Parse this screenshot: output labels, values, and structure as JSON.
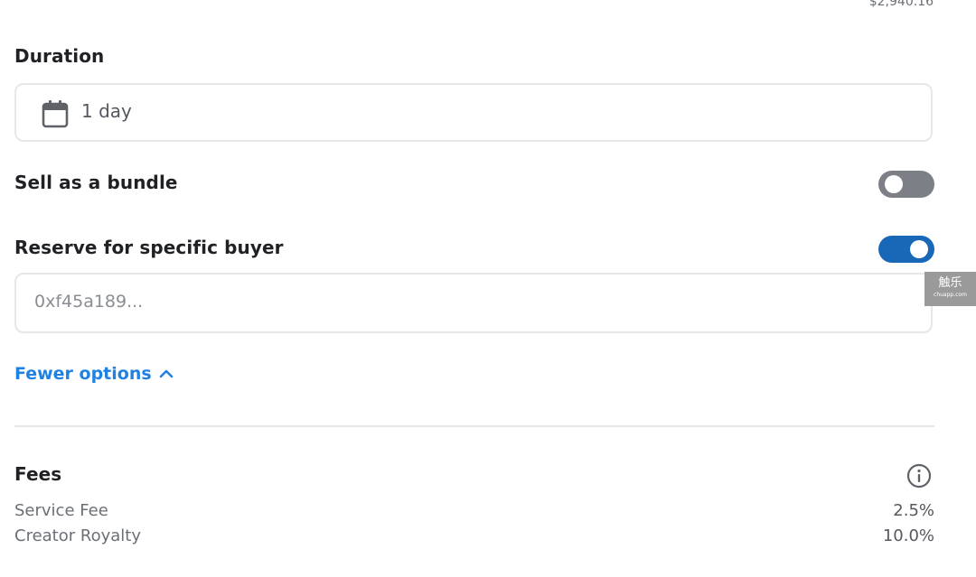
{
  "header": {
    "price": "$2,940.16"
  },
  "duration": {
    "label": "Duration",
    "value": "1 day",
    "icon": "calendar-icon"
  },
  "bundle": {
    "label": "Sell as a bundle",
    "enabled": false
  },
  "reserve": {
    "label": "Reserve for specific buyer",
    "enabled": true,
    "placeholder": "0xf45a189..."
  },
  "options_toggle": {
    "label": "Fewer options",
    "icon": "chevron-up-icon"
  },
  "fees": {
    "title": "Fees",
    "icon": "info-icon",
    "items": [
      {
        "label": "Service Fee",
        "value": "2.5%"
      },
      {
        "label": "Creator Royalty",
        "value": "10.0%"
      }
    ]
  },
  "watermark": {
    "main": "触乐",
    "sub": "chuapp.com"
  },
  "colors": {
    "accent": "#2081e2",
    "toggle_on": "#1868b7",
    "toggle_off": "#7c8086",
    "border": "#e5e8eb"
  }
}
